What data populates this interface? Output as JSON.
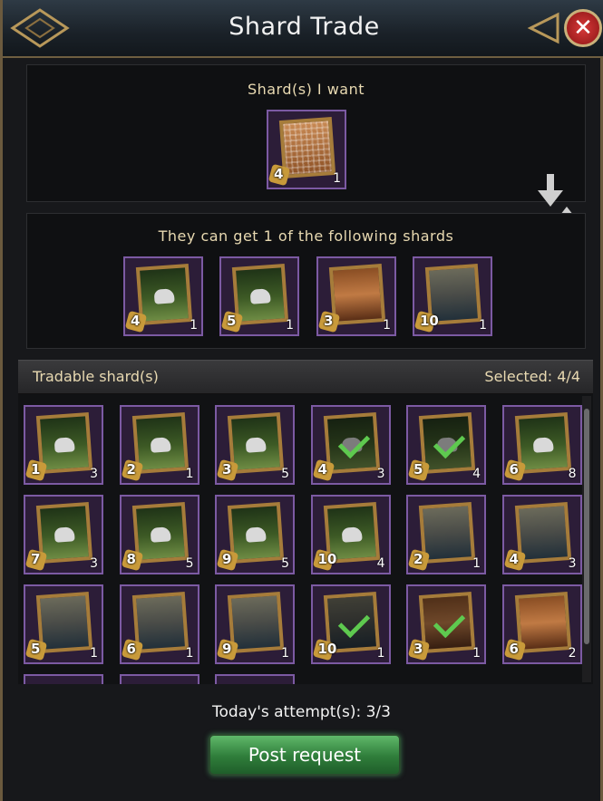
{
  "title": "Shard Trade",
  "want_section": {
    "label": "Shard(s) I want",
    "shard": {
      "art": "grid",
      "piece": "4",
      "count": "1"
    }
  },
  "offer_section": {
    "label": "They can get 1 of the following shards",
    "shards": [
      {
        "art": "horse",
        "piece": "4",
        "count": "1"
      },
      {
        "art": "horse",
        "piece": "5",
        "count": "1"
      },
      {
        "art": "man",
        "piece": "3",
        "count": "1"
      },
      {
        "art": "sky",
        "piece": "10",
        "count": "1"
      }
    ]
  },
  "tradable": {
    "label": "Tradable shard(s)",
    "selected": "Selected: 4/4",
    "shards": [
      {
        "art": "horse",
        "piece": "1",
        "count": "3",
        "selected": false
      },
      {
        "art": "horse",
        "piece": "2",
        "count": "1",
        "selected": false
      },
      {
        "art": "horse",
        "piece": "3",
        "count": "5",
        "selected": false
      },
      {
        "art": "horse",
        "piece": "4",
        "count": "3",
        "selected": true
      },
      {
        "art": "horse",
        "piece": "5",
        "count": "4",
        "selected": true
      },
      {
        "art": "horse",
        "piece": "6",
        "count": "8",
        "selected": false
      },
      {
        "art": "horse",
        "piece": "7",
        "count": "3",
        "selected": false
      },
      {
        "art": "horse",
        "piece": "8",
        "count": "5",
        "selected": false
      },
      {
        "art": "horse",
        "piece": "9",
        "count": "5",
        "selected": false
      },
      {
        "art": "horse",
        "piece": "10",
        "count": "4",
        "selected": false
      },
      {
        "art": "sky",
        "piece": "2",
        "count": "1",
        "selected": false
      },
      {
        "art": "sky",
        "piece": "4",
        "count": "3",
        "selected": false
      },
      {
        "art": "sky",
        "piece": "5",
        "count": "1",
        "selected": false
      },
      {
        "art": "sky",
        "piece": "6",
        "count": "1",
        "selected": false
      },
      {
        "art": "sky",
        "piece": "9",
        "count": "1",
        "selected": false
      },
      {
        "art": "sky",
        "piece": "10",
        "count": "1",
        "selected": true
      },
      {
        "art": "man",
        "piece": "3",
        "count": "1",
        "selected": true
      },
      {
        "art": "man",
        "piece": "6",
        "count": "2",
        "selected": false
      }
    ]
  },
  "attempts": "Today's attempt(s): 3/3",
  "post_button": "Post request",
  "icons": {
    "close": "close-icon",
    "swap": "swap-arrows-icon",
    "puzzle": "puzzle-piece-icon",
    "check": "checkmark-icon"
  },
  "colors": {
    "selected_check": "#5ec94f",
    "button_green": "#2f7d3a",
    "shard_border": "#7c5aa3"
  }
}
